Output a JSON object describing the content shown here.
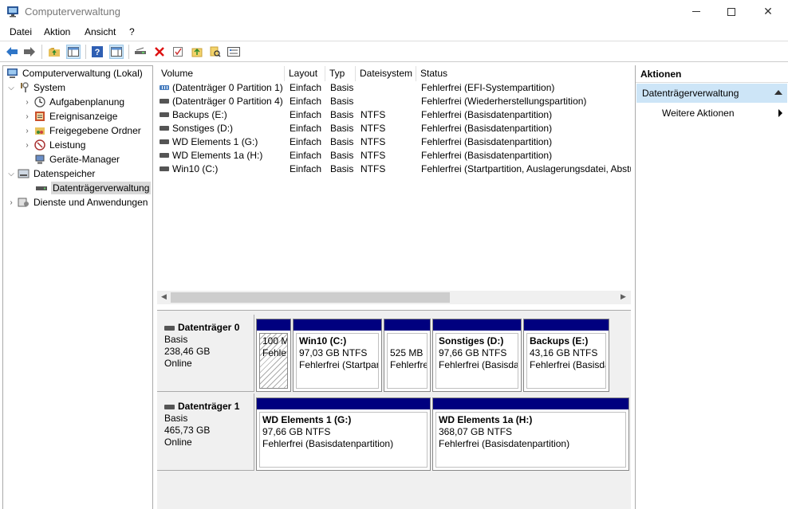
{
  "window": {
    "title": "Computerverwaltung",
    "min_label": "—",
    "max_label": "☐",
    "close_label": "✕"
  },
  "menu": {
    "items": [
      "Datei",
      "Aktion",
      "Ansicht",
      "?"
    ]
  },
  "toolbar": {
    "buttons": [
      "back-icon",
      "forward-icon",
      "up-folder-icon",
      "show-hide-tree-icon",
      "help-icon",
      "properties-pane-icon",
      "connect-icon",
      "delete-icon",
      "check-icon",
      "export-icon",
      "search-icon",
      "settings-icon"
    ]
  },
  "tree": {
    "items": [
      {
        "label": "Computerverwaltung (Lokal)",
        "icon": "computer-management-icon"
      },
      {
        "label": "System",
        "icon": "system-tools-icon"
      },
      {
        "label": "Aufgabenplanung",
        "icon": "task-scheduler-icon"
      },
      {
        "label": "Ereignisanzeige",
        "icon": "event-viewer-icon"
      },
      {
        "label": "Freigegebene Ordner",
        "icon": "shared-folders-icon"
      },
      {
        "label": "Leistung",
        "icon": "performance-icon"
      },
      {
        "label": "Geräte-Manager",
        "icon": "device-manager-icon"
      },
      {
        "label": "Datenspeicher",
        "icon": "storage-icon"
      },
      {
        "label": "Datenträgerverwaltung",
        "icon": "disk-management-icon"
      },
      {
        "label": "Dienste und Anwendungen",
        "icon": "services-icon"
      }
    ]
  },
  "volumes": {
    "columns": [
      "Volume",
      "Layout",
      "Typ",
      "Dateisystem",
      "Status"
    ],
    "rows": [
      {
        "volume": "(Datenträger 0 Partition 1)",
        "layout": "Einfach",
        "typ": "Basis",
        "fs": "",
        "status": "Fehlerfrei (EFI-Systempartition)"
      },
      {
        "volume": "(Datenträger 0 Partition 4)",
        "layout": "Einfach",
        "typ": "Basis",
        "fs": "",
        "status": "Fehlerfrei (Wiederherstellungspartition)"
      },
      {
        "volume": "Backups (E:)",
        "layout": "Einfach",
        "typ": "Basis",
        "fs": "NTFS",
        "status": "Fehlerfrei (Basisdatenpartition)"
      },
      {
        "volume": "Sonstiges (D:)",
        "layout": "Einfach",
        "typ": "Basis",
        "fs": "NTFS",
        "status": "Fehlerfrei (Basisdatenpartition)"
      },
      {
        "volume": "WD Elements 1 (G:)",
        "layout": "Einfach",
        "typ": "Basis",
        "fs": "NTFS",
        "status": "Fehlerfrei (Basisdatenpartition)"
      },
      {
        "volume": "WD Elements 1a (H:)",
        "layout": "Einfach",
        "typ": "Basis",
        "fs": "NTFS",
        "status": "Fehlerfrei (Basisdatenpartition)"
      },
      {
        "volume": "Win10 (C:)",
        "layout": "Einfach",
        "typ": "Basis",
        "fs": "NTFS",
        "status": "Fehlerfrei (Startpartition, Auslagerungsdatei, Abstu"
      }
    ]
  },
  "disks": [
    {
      "name": "Datenträger 0",
      "type": "Basis",
      "size": "238,46 GB",
      "state": "Online",
      "partitions": [
        {
          "name": "",
          "line1": "100 M",
          "line2": "Fehle",
          "hatched": true
        },
        {
          "name": "Win10  (C:)",
          "line1": "97,03 GB NTFS",
          "line2": "Fehlerfrei (Startpar",
          "hatched": false
        },
        {
          "name": "",
          "line1": "525 MB",
          "line2": "Fehlerfre",
          "hatched": false
        },
        {
          "name": "Sonstiges  (D:)",
          "line1": "97,66 GB NTFS",
          "line2": "Fehlerfrei (Basisdat",
          "hatched": false
        },
        {
          "name": "Backups  (E:)",
          "line1": "43,16 GB NTFS",
          "line2": "Fehlerfrei (Basisda",
          "hatched": false
        }
      ]
    },
    {
      "name": "Datenträger 1",
      "type": "Basis",
      "size": "465,73 GB",
      "state": "Online",
      "partitions": [
        {
          "name": "WD Elements 1  (G:)",
          "line1": "97,66 GB NTFS",
          "line2": "Fehlerfrei (Basisdatenpartition)",
          "hatched": false
        },
        {
          "name": "WD Elements 1a  (H:)",
          "line1": "368,07 GB NTFS",
          "line2": "Fehlerfrei (Basisdatenpartition)",
          "hatched": false
        }
      ]
    }
  ],
  "actions": {
    "header": "Aktionen",
    "section": "Datenträgerverwaltung",
    "more": "Weitere Aktionen"
  }
}
